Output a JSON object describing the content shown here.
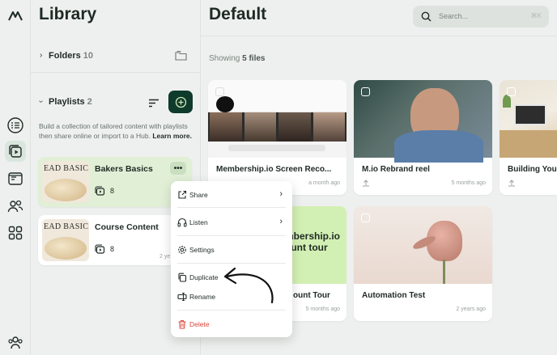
{
  "library": {
    "title": "Library",
    "folders": {
      "label": "Folders",
      "count": "10"
    },
    "playlists": {
      "label": "Playlists",
      "count": "2"
    },
    "description": "Build a collection of tailored content with playlists then share online or import to a Hub.",
    "learn_more": "Learn more.",
    "items": [
      {
        "name": "Bakers Basics",
        "thumb_text": "EAD BASIC",
        "count": "8",
        "menu_btn": "•••"
      },
      {
        "name": "Course Content",
        "thumb_text": "EAD BASIC",
        "count": "8",
        "time": "2 ye"
      }
    ]
  },
  "main": {
    "title": "Default",
    "search_placeholder": "Search...",
    "search_shortcut": "⌘K",
    "showing_prefix": "Showing",
    "showing_count": "5 files",
    "videos": [
      {
        "title": "Membership.io Screen Reco...",
        "time": "a month ago"
      },
      {
        "title": "M.io Rebrand reel",
        "time": "5 months ago"
      },
      {
        "title": "Building Your",
        "time": ""
      },
      {
        "title": "ount Tour",
        "time": "5 months ago",
        "thumb_text": "mbership.io\nount tour"
      },
      {
        "title": "Automation Test",
        "time": "2 years ago"
      }
    ]
  },
  "context_menu": {
    "share": "Share",
    "listen": "Listen",
    "settings": "Settings",
    "duplicate": "Duplicate",
    "rename": "Rename",
    "delete": "Delete"
  },
  "colors": {
    "accent_dark": "#0f3b2c",
    "selected_card": "#e2efd7",
    "danger": "#d9473c"
  }
}
